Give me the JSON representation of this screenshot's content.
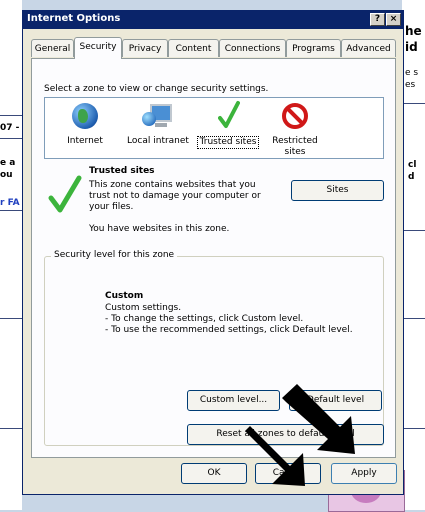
{
  "window": {
    "title": "Internet Options",
    "help_label": "?",
    "close_label": "×"
  },
  "tabs": [
    {
      "label": "General"
    },
    {
      "label": "Security"
    },
    {
      "label": "Privacy"
    },
    {
      "label": "Content"
    },
    {
      "label": "Connections"
    },
    {
      "label": "Programs"
    },
    {
      "label": "Advanced"
    }
  ],
  "zones": {
    "instruction": "Select a zone to view or change security settings.",
    "items": [
      {
        "label": "Internet",
        "icon": "globe-icon"
      },
      {
        "label": "Local intranet",
        "icon": "monitor-globe-icon"
      },
      {
        "label": "Trusted sites",
        "icon": "checkmark-icon"
      },
      {
        "label": "Restricted sites",
        "icon": "no-entry-icon"
      }
    ],
    "selected": "Trusted sites"
  },
  "trusted": {
    "title": "Trusted sites",
    "description": "This zone contains websites that you trust not to damage your computer or your files.",
    "has_sites": "You have websites in this zone.",
    "sites_button": "Sites"
  },
  "security_level": {
    "group_label": "Security level for this zone",
    "level_name": "Custom",
    "line1": "Custom settings.",
    "line2": "- To change the settings, click Custom level.",
    "line3": "- To use the recommended settings, click Default level.",
    "custom_level_button": "Custom level...",
    "default_level_button": "Default level",
    "reset_button": "Reset all zones to default level"
  },
  "buttons": {
    "ok": "OK",
    "cancel": "Cancel",
    "apply": "Apply"
  },
  "background": {
    "frag_top_right_1": "he",
    "frag_top_right_2": "id",
    "frag_right_3": "e s",
    "frag_right_4": "es",
    "frag_left_1": "07 -",
    "frag_left_2": "e a",
    "frag_left_3": "ou",
    "frag_left_4": "r FA",
    "frag_right_5": "cl",
    "frag_right_6": "d"
  },
  "colors": {
    "titlebar": "#0a246a",
    "dialog_bg": "#ece9d8",
    "panel_bg": "#fcfcfe",
    "check_green": "#3cb43c",
    "restricted_red": "#d01818"
  }
}
